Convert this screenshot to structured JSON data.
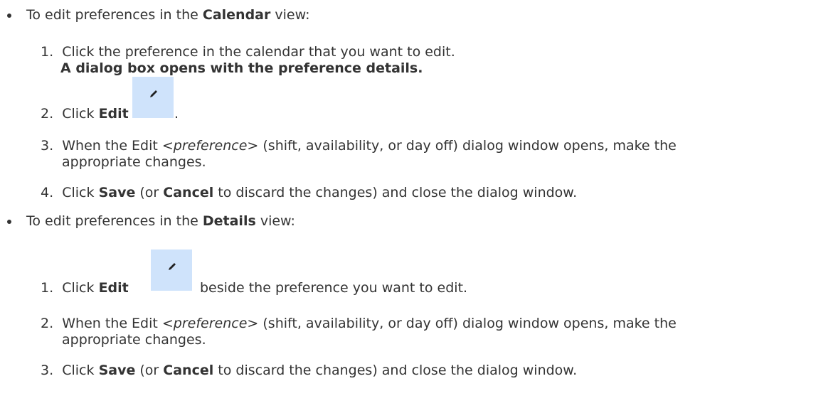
{
  "section1": {
    "intro_prefix": "To edit preferences in the ",
    "intro_bold": "Calendar",
    "intro_suffix": " view:",
    "steps": [
      {
        "num": "1.",
        "text": "Click the preference in the calendar that you want to edit.",
        "result": "A dialog box opens with the preference details."
      },
      {
        "num": "2.",
        "prefix": "Click ",
        "bold": "Edit",
        "suffix": ".",
        "icon": "pencil-icon"
      },
      {
        "num": "3.",
        "prefix": "When the Edit ",
        "italic": "<preference>",
        "suffix": " (shift, availability, or day off) dialog window opens, make the",
        "continuation": "appropriate changes."
      },
      {
        "num": "4.",
        "prefix": "Click ",
        "bold1": "Save",
        "middle": " (or ",
        "bold2": "Cancel",
        "suffix": " to discard the changes) and close the dialog window."
      }
    ]
  },
  "section2": {
    "intro_prefix": "To edit preferences in the ",
    "intro_bold": "Details",
    "intro_suffix": " view:",
    "steps": [
      {
        "num": "1.",
        "prefix": "Click ",
        "bold": "Edit",
        "suffix": "beside the preference you want to edit.",
        "icon": "pencil-icon"
      },
      {
        "num": "2.",
        "prefix": "When the Edit ",
        "italic": "<preference>",
        "suffix": " (shift, availability, or day off) dialog window opens, make the",
        "continuation": "appropriate changes."
      },
      {
        "num": "3.",
        "prefix": "Click ",
        "bold1": "Save",
        "middle": " (or ",
        "bold2": "Cancel",
        "suffix": " to discard the changes) and close the dialog window."
      }
    ]
  },
  "colors": {
    "text": "#333333",
    "icon_background": "#cfe3fb"
  }
}
